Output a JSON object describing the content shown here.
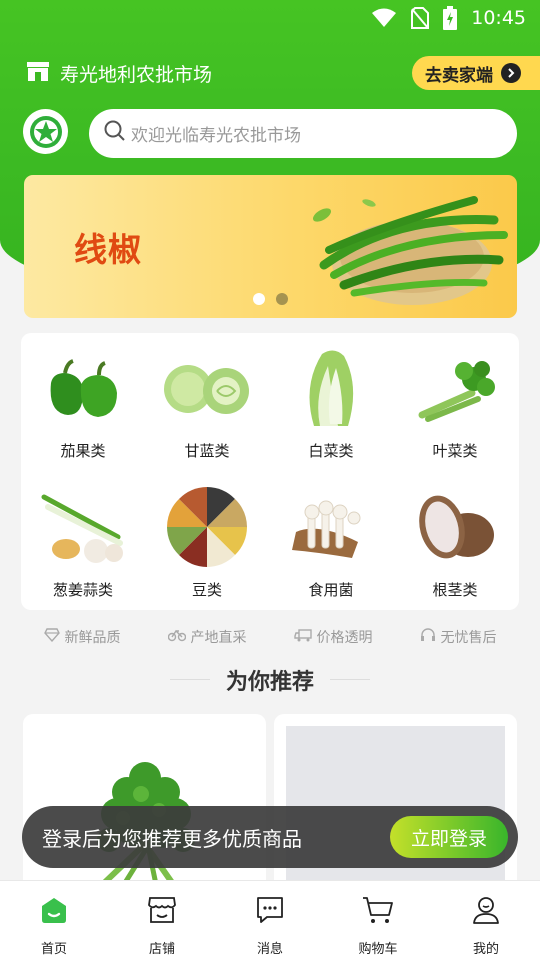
{
  "status_bar": {
    "time": "10:45"
  },
  "header": {
    "market_name": "寿光地利农批市场",
    "seller_button": "去卖家端"
  },
  "search": {
    "placeholder": "欢迎光临寿光农批市场"
  },
  "banner": {
    "title": "线椒",
    "dots": 2,
    "active_dot": 0
  },
  "categories": [
    {
      "label": "茄果类",
      "icon": "bell-pepper-icon"
    },
    {
      "label": "甘蓝类",
      "icon": "cabbage-icon"
    },
    {
      "label": "白菜类",
      "icon": "napa-cabbage-icon"
    },
    {
      "label": "叶菜类",
      "icon": "celery-icon"
    },
    {
      "label": "葱姜蒜类",
      "icon": "scallion-ginger-garlic-icon"
    },
    {
      "label": "豆类",
      "icon": "beans-icon"
    },
    {
      "label": "食用菌",
      "icon": "mushroom-icon"
    },
    {
      "label": "根茎类",
      "icon": "taro-icon"
    }
  ],
  "features": [
    {
      "label": "新鲜品质",
      "icon": "diamond-icon"
    },
    {
      "label": "产地直采",
      "icon": "bicycle-icon"
    },
    {
      "label": "价格透明",
      "icon": "truck-icon"
    },
    {
      "label": "无忧售后",
      "icon": "headset-icon"
    }
  ],
  "recommend": {
    "title": "为你推荐"
  },
  "toast": {
    "text": "登录后为您推荐更多优质商品",
    "button": "立即登录"
  },
  "tabs": [
    {
      "label": "首页",
      "icon": "home-icon",
      "active": true
    },
    {
      "label": "店铺",
      "icon": "store-icon"
    },
    {
      "label": "消息",
      "icon": "message-icon"
    },
    {
      "label": "购物车",
      "icon": "cart-icon"
    },
    {
      "label": "我的",
      "icon": "profile-icon"
    }
  ],
  "colors": {
    "brand_green": "#3cba23",
    "accent_yellow": "#ffd84f",
    "banner_title": "#e04a12"
  }
}
